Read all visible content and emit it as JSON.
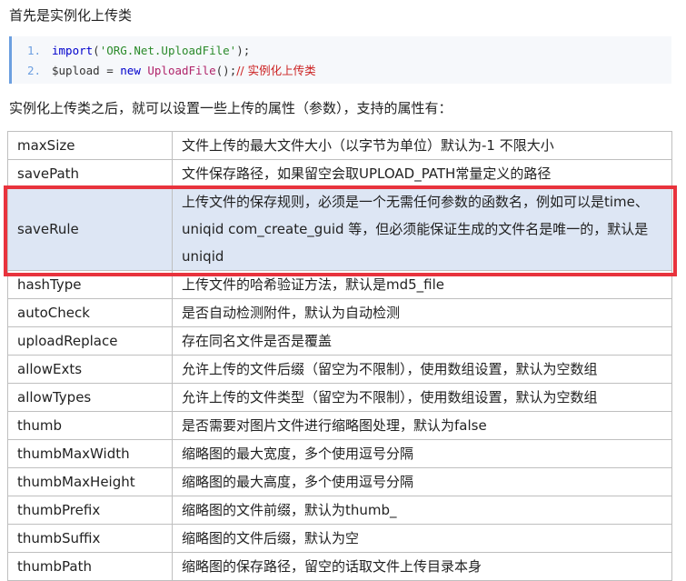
{
  "intro": "首先是实例化上传类",
  "code": {
    "lines": [
      {
        "num": "1.",
        "kw": "import",
        "p1": "(",
        "str": "'ORG.Net.UploadFile'",
        "p2": ");"
      },
      {
        "num": "2.",
        "var": "$upload",
        "eq": " = ",
        "kw": "new",
        "cls": "UploadFile",
        "p": "();",
        "cmt": "// 实例化上传类"
      }
    ]
  },
  "description": "实例化上传类之后，就可以设置一些上传的属性（参数），支持的属性有：",
  "accent_color": "#e8333d",
  "table": {
    "rows": [
      {
        "name": "maxSize",
        "desc": "文件上传的最大文件大小（以字节为单位）默认为-1 不限大小"
      },
      {
        "name": "savePath",
        "desc": "文件保存路径，如果留空会取UPLOAD_PATH常量定义的路径"
      },
      {
        "name": "saveRule",
        "desc": "上传文件的保存规则，必须是一个无需任何参数的函数名，例如可以是time、 uniqid com_create_guid 等，但必须能保证生成的文件名是唯一的，默认是uniqid"
      },
      {
        "name": "hashType",
        "desc": "上传文件的哈希验证方法，默认是md5_file"
      },
      {
        "name": "autoCheck",
        "desc": "是否自动检测附件，默认为自动检测"
      },
      {
        "name": "uploadReplace",
        "desc": "存在同名文件是否是覆盖"
      },
      {
        "name": "allowExts",
        "desc": "允许上传的文件后缀（留空为不限制），使用数组设置，默认为空数组"
      },
      {
        "name": "allowTypes",
        "desc": "允许上传的文件类型（留空为不限制），使用数组设置，默认为空数组"
      },
      {
        "name": "thumb",
        "desc": "是否需要对图片文件进行缩略图处理，默认为false"
      },
      {
        "name": "thumbMaxWidth",
        "desc": "缩略图的最大宽度，多个使用逗号分隔"
      },
      {
        "name": "thumbMaxHeight",
        "desc": "缩略图的最大高度，多个使用逗号分隔"
      },
      {
        "name": "thumbPrefix",
        "desc": "缩略图的文件前缀，默认为thumb_"
      },
      {
        "name": "thumbSuffix",
        "desc": "缩略图的文件后缀，默认为空"
      },
      {
        "name": "thumbPath",
        "desc": "缩略图的保存路径，留空的话取文件上传目录本身"
      }
    ]
  }
}
